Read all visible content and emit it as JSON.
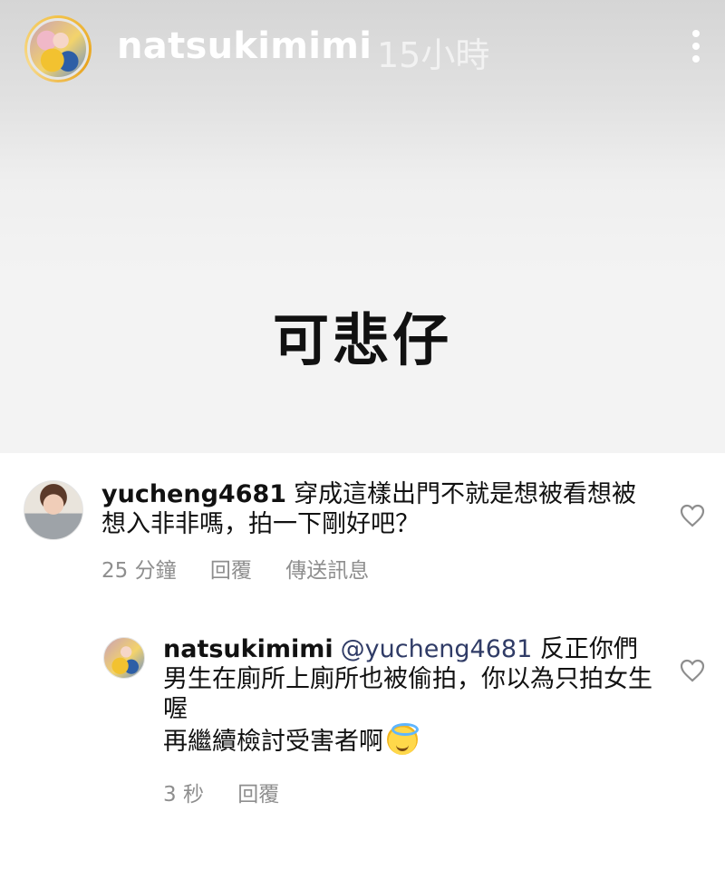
{
  "story": {
    "username": "natsukimimi",
    "time": "15小時",
    "text": "可悲仔"
  },
  "comments": [
    {
      "username": "yucheng4681",
      "text": "穿成這樣出門不就是想被看想被想入非非嗎，拍一下剛好吧？",
      "time": "25 分鐘",
      "reply_label": "回覆",
      "send_label": "傳送訊息"
    },
    {
      "username": "natsukimimi",
      "mention": "@yucheng4681",
      "text_line1": " 反正你們男生在廁所上廁所也被偷拍，你以為只拍女生喔",
      "text_line2": "再繼續檢討受害者啊",
      "emoji": "smiling-face-with-halo",
      "time": "3 秒",
      "reply_label": "回覆"
    }
  ],
  "icons": {
    "more": "more-vertical-icon",
    "like": "heart-outline-icon"
  },
  "colors": {
    "username_story": "#ffffff",
    "meta_gray": "#8e8e8e",
    "mention": "#2f3b66"
  }
}
